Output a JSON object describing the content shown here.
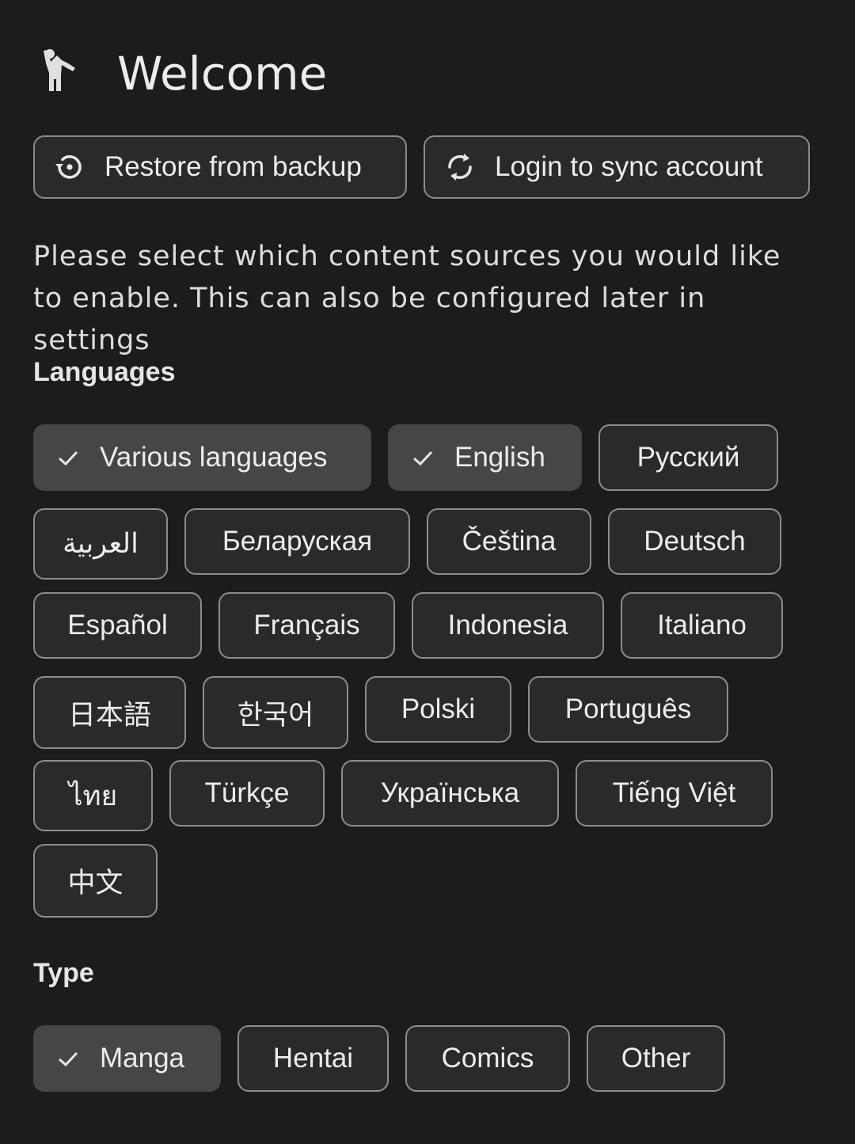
{
  "header": {
    "title": "Welcome",
    "icon": "person-waving-icon"
  },
  "actions": {
    "restore_label": "Restore from backup",
    "restore_icon": "restore-history-icon",
    "login_label": "Login to sync account",
    "login_icon": "sync-icon"
  },
  "description": "Please select which content sources you would like to enable. This can also be configured later in settings",
  "languages": {
    "title": "Languages",
    "items": [
      {
        "label": "Various languages",
        "selected": true
      },
      {
        "label": "English",
        "selected": true
      },
      {
        "label": "Русский",
        "selected": false
      },
      {
        "label": "العربية",
        "selected": false
      },
      {
        "label": "Беларуская",
        "selected": false
      },
      {
        "label": "Čeština",
        "selected": false
      },
      {
        "label": "Deutsch",
        "selected": false
      },
      {
        "label": "Español",
        "selected": false
      },
      {
        "label": "Français",
        "selected": false
      },
      {
        "label": "Indonesia",
        "selected": false
      },
      {
        "label": "Italiano",
        "selected": false
      },
      {
        "label": "日本語",
        "selected": false
      },
      {
        "label": "한국어",
        "selected": false
      },
      {
        "label": "Polski",
        "selected": false
      },
      {
        "label": "Português",
        "selected": false
      },
      {
        "label": "ไทย",
        "selected": false
      },
      {
        "label": "Türkçe",
        "selected": false
      },
      {
        "label": "Українська",
        "selected": false
      },
      {
        "label": "Tiếng Việt",
        "selected": false
      },
      {
        "label": "中文",
        "selected": false
      }
    ]
  },
  "types": {
    "title": "Type",
    "items": [
      {
        "label": "Manga",
        "selected": true
      },
      {
        "label": "Hentai",
        "selected": false
      },
      {
        "label": "Comics",
        "selected": false
      },
      {
        "label": "Other",
        "selected": false
      }
    ]
  },
  "colors": {
    "background": "#1c1c1c",
    "chip_selected": "#464646",
    "chip_border": "#8c8c8c"
  }
}
